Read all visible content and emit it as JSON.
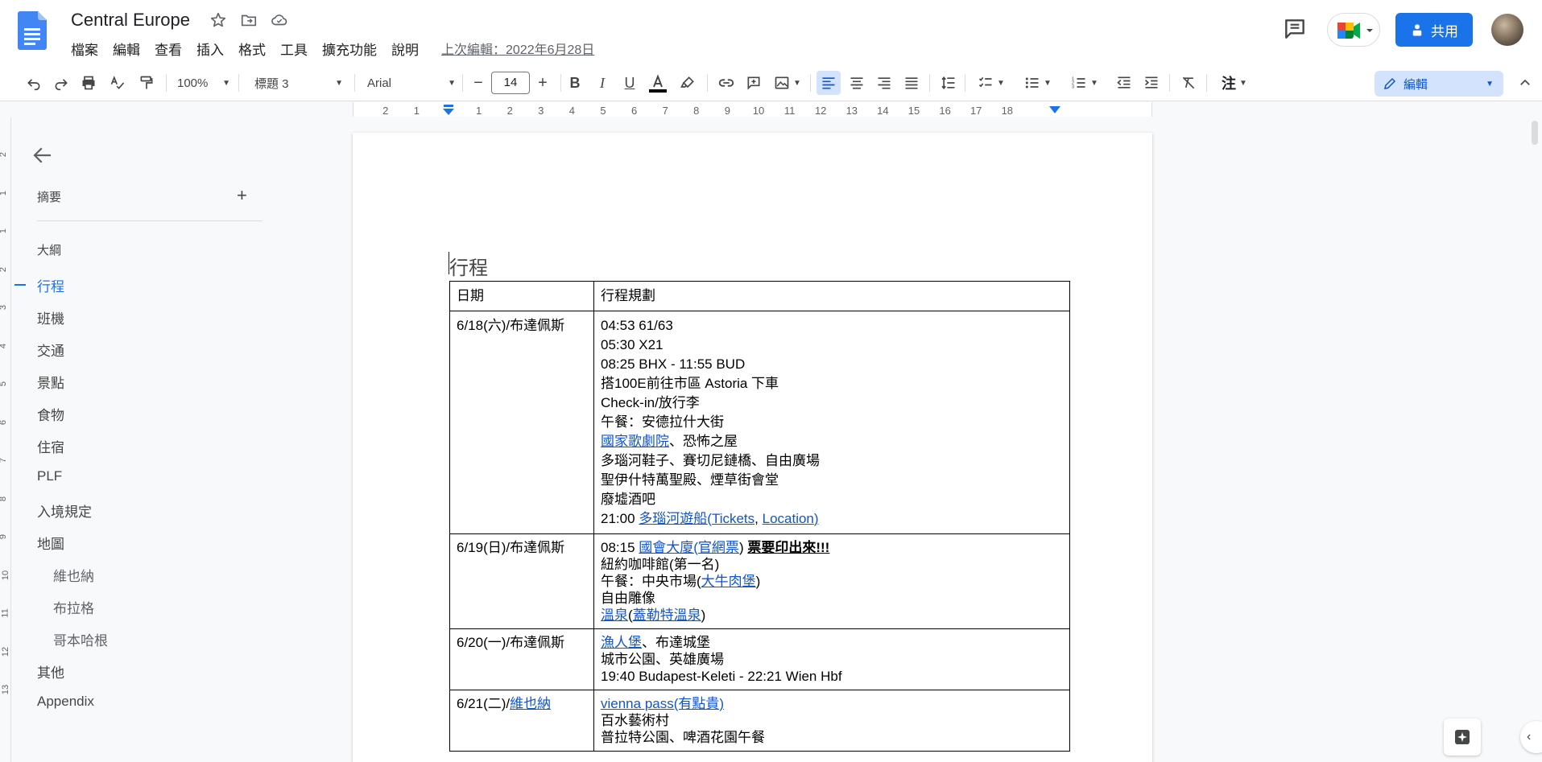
{
  "header": {
    "title": "Central Europe",
    "menus": [
      "檔案",
      "編輯",
      "查看",
      "插入",
      "格式",
      "工具",
      "擴充功能",
      "說明"
    ],
    "last_edit": "上次編輯：2022年6月28日",
    "share_label": "共用"
  },
  "toolbar": {
    "zoom": "100%",
    "style": "標題 3",
    "font": "Arial",
    "font_size": "14",
    "mode": "編輯"
  },
  "ruler": {
    "numbers": [
      "2",
      "1",
      "1",
      "2",
      "3",
      "4",
      "5",
      "6",
      "7",
      "8",
      "9",
      "10",
      "11",
      "12",
      "13",
      "14",
      "15",
      "16",
      "17",
      "18"
    ],
    "vertical_numbers": [
      "2",
      "1",
      "1",
      "2",
      "3",
      "4",
      "5",
      "6",
      "7",
      "8",
      "9",
      "10",
      "11",
      "12",
      "13"
    ]
  },
  "sidebar": {
    "summary_label": "摘要",
    "outline_label": "大綱",
    "items": [
      {
        "label": "行程",
        "level": 1,
        "active": true
      },
      {
        "label": "班機",
        "level": 1
      },
      {
        "label": "交通",
        "level": 1
      },
      {
        "label": "景點",
        "level": 1
      },
      {
        "label": "食物",
        "level": 1
      },
      {
        "label": "住宿",
        "level": 1
      },
      {
        "label": "PLF",
        "level": 1
      },
      {
        "label": "入境規定",
        "level": 1
      },
      {
        "label": "地圖",
        "level": 1
      },
      {
        "label": "維也納",
        "level": 2
      },
      {
        "label": "布拉格",
        "level": 2
      },
      {
        "label": "哥本哈根",
        "level": 2
      },
      {
        "label": "其他",
        "level": 1
      },
      {
        "label": "Appendix",
        "level": 1
      }
    ]
  },
  "document": {
    "heading": "行程",
    "table": {
      "headers": [
        "日期",
        "行程規劃"
      ],
      "rows": [
        {
          "date": "6/18(六)/布達佩斯",
          "lines": [
            "04:53 61/63",
            "05:30 X21",
            "08:25 BHX - 11:55 BUD",
            "搭100E前往市區 Astoria 下車",
            "Check-in/放行李",
            "午餐：安德拉什大街",
            "國家歌劇院",
            "、恐怖之屋",
            "多瑙河鞋子、賽切尼鏈橋、自由廣場",
            "聖伊什特萬聖殿、煙草街會堂",
            "廢墟酒吧",
            "21:00 ",
            "多瑙河遊船",
            "(",
            "Tickets",
            ", ",
            "Location",
            ")"
          ]
        },
        {
          "date": "6/19(日)/布達佩斯",
          "lines": [
            "08:15 ",
            "國會大廈",
            "(",
            "官網票",
            ")",
            "票要印出來!!!",
            "紐約咖啡館(第一名)",
            "午餐：中央市場(",
            "大牛肉堡",
            ")",
            "自由雕像",
            "溫泉",
            "(",
            "蓋勒特溫泉",
            ")"
          ]
        },
        {
          "date": "6/20(一)/布達佩斯",
          "lines": [
            "漁人堡",
            "、布達城堡",
            "城市公園、英雄廣場",
            "19:40 Budapest-Keleti - 22:21 Wien Hbf"
          ]
        },
        {
          "date_prefix": "6/21(二)/",
          "date_link": "維也納",
          "lines": [
            "vienna pass(有點貴)",
            "百水藝術村",
            "普拉特公園、啤酒花園午餐"
          ]
        }
      ]
    }
  },
  "colors": {
    "accent": "#1a73e8",
    "link": "#1155cc",
    "edit_mode_bg": "#d3e3fd"
  }
}
